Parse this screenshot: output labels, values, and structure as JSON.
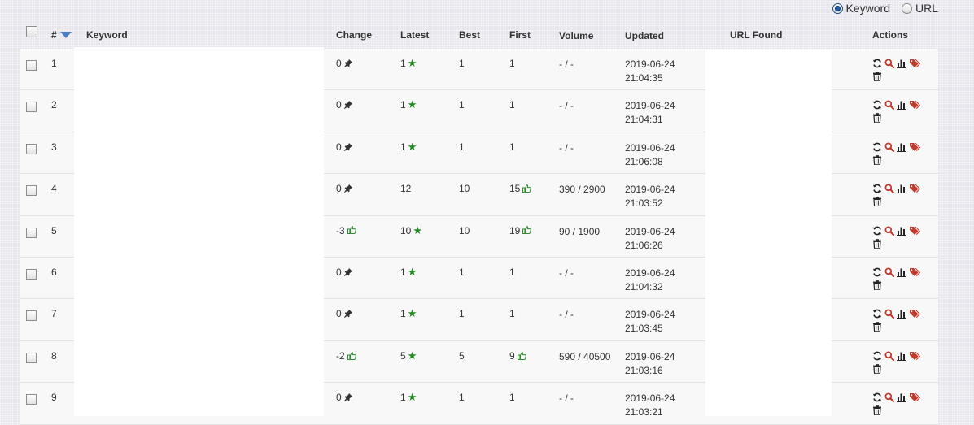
{
  "filter": {
    "keyword_label": "Keyword",
    "url_label": "URL",
    "selected": "keyword"
  },
  "columns": {
    "num": "#",
    "keyword": "Keyword",
    "change": "Change",
    "latest": "Latest",
    "best": "Best",
    "first": "First",
    "volume": "Volume",
    "updated": "Updated",
    "url_found": "URL Found",
    "actions": "Actions"
  },
  "rows": [
    {
      "num": "1",
      "change": "0",
      "change_icon": "pin-icon",
      "latest": "1",
      "latest_icon": "star-icon",
      "best": "1",
      "first": "1",
      "first_icon": "",
      "volume": "- / -",
      "updated_date": "2019-06-24",
      "updated_time": "21:04:35"
    },
    {
      "num": "2",
      "change": "0",
      "change_icon": "pin-icon",
      "latest": "1",
      "latest_icon": "star-icon",
      "best": "1",
      "first": "1",
      "first_icon": "",
      "volume": "- / -",
      "updated_date": "2019-06-24",
      "updated_time": "21:04:31"
    },
    {
      "num": "3",
      "change": "0",
      "change_icon": "pin-icon",
      "latest": "1",
      "latest_icon": "star-icon",
      "best": "1",
      "first": "1",
      "first_icon": "",
      "volume": "- / -",
      "updated_date": "2019-06-24",
      "updated_time": "21:06:08"
    },
    {
      "num": "4",
      "change": "0",
      "change_icon": "pin-icon",
      "latest": "12",
      "latest_icon": "",
      "best": "10",
      "first": "15",
      "first_icon": "thumbs-up-icon",
      "volume": "390 / 2900",
      "updated_date": "2019-06-24",
      "updated_time": "21:03:52"
    },
    {
      "num": "5",
      "change": "-3",
      "change_icon": "thumbs-up-icon",
      "latest": "10",
      "latest_icon": "star-icon",
      "best": "10",
      "first": "19",
      "first_icon": "thumbs-up-icon",
      "volume": "90 / 1900",
      "updated_date": "2019-06-24",
      "updated_time": "21:06:26"
    },
    {
      "num": "6",
      "change": "0",
      "change_icon": "pin-icon",
      "latest": "1",
      "latest_icon": "star-icon",
      "best": "1",
      "first": "1",
      "first_icon": "",
      "volume": "- / -",
      "updated_date": "2019-06-24",
      "updated_time": "21:04:32"
    },
    {
      "num": "7",
      "change": "0",
      "change_icon": "pin-icon",
      "latest": "1",
      "latest_icon": "star-icon",
      "best": "1",
      "first": "1",
      "first_icon": "",
      "volume": "- / -",
      "updated_date": "2019-06-24",
      "updated_time": "21:03:45"
    },
    {
      "num": "8",
      "change": "-2",
      "change_icon": "thumbs-up-icon",
      "latest": "5",
      "latest_icon": "star-icon",
      "best": "5",
      "first": "9",
      "first_icon": "thumbs-up-icon",
      "volume": "590 / 40500",
      "updated_date": "2019-06-24",
      "updated_time": "21:03:16"
    },
    {
      "num": "9",
      "change": "0",
      "change_icon": "pin-icon",
      "latest": "1",
      "latest_icon": "star-icon",
      "best": "1",
      "first": "1",
      "first_icon": "",
      "volume": "- / -",
      "updated_date": "2019-06-24",
      "updated_time": "21:03:21"
    }
  ],
  "colors": {
    "star": "#1f8a1f",
    "thumb": "#2e8b2e",
    "search": "#c0392b",
    "tag": "#c0392b",
    "sort": "#4a7fc4"
  }
}
